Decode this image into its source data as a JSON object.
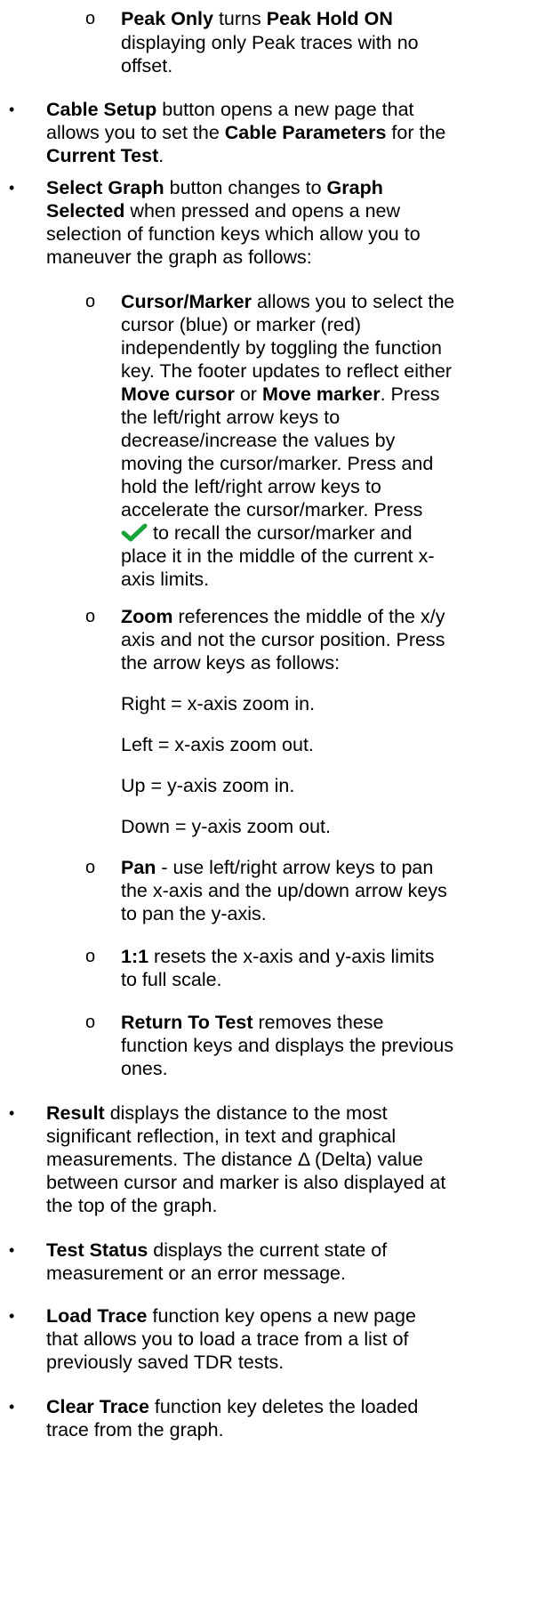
{
  "peak_only": {
    "bullet": "o",
    "t1": "Peak Only",
    "t2": " turns ",
    "t3": "Peak Hold ON",
    "line2": "displaying only Peak traces with no",
    "line3": "offset."
  },
  "cable_setup": {
    "bullet": "•",
    "t1": "Cable Setup",
    "t2": " button opens a new page that",
    "line2a": "allows you to set the ",
    "line2b": "Cable Parameters",
    "line2c": " for the",
    "line3a": "Current Test",
    "line3b": "."
  },
  "select_graph": {
    "bullet": "•",
    "t1": "Select Graph",
    "t2": " button changes to ",
    "t3": "Graph",
    "line2a": "Selected",
    "line2b": " when pressed and opens a new",
    "line3": "selection of function keys which allow you to",
    "line4": "maneuver the graph as follows:"
  },
  "cursor_marker": {
    "bullet": "o",
    "t1": "Cursor/Marker",
    "t2": " allows you to select the",
    "l2": "cursor (blue) or marker (red)",
    "l3": "independently by toggling the function",
    "l4": "key. The footer updates to reflect either",
    "l5a": "Move cursor",
    "l5b": " or ",
    "l5c": "Move marker",
    "l5d": ". Press",
    "l6": "the left/right arrow keys to",
    "l7": "decrease/increase the values by",
    "l8": "moving the cursor/marker. Press and",
    "l9": "hold the left/right arrow keys to",
    "l10": "accelerate the cursor/marker. Press",
    "l11": " to recall the cursor/marker and",
    "l12": "place it in the middle of the current x-",
    "l13": "axis limits.",
    "check_icon_color": "#1aa33a"
  },
  "zoom": {
    "bullet": "o",
    "t1": "Zoom",
    "t2": " references the middle of the x/y",
    "l2": "axis and not the cursor position. Press",
    "l3": "the arrow keys as follows:",
    "right": "Right = x-axis zoom in.",
    "left": "Left = x-axis zoom out.",
    "up": "Up = y-axis zoom in.",
    "down": "Down = y-axis zoom out."
  },
  "pan": {
    "bullet": "o",
    "t1": "Pan",
    "t2": " - use left/right arrow keys to pan",
    "l2": "the x-axis and the up/down arrow keys",
    "l3": "to pan the y-axis."
  },
  "one_to_one": {
    "bullet": "o",
    "t1": "1:1",
    "t2": " resets the x-axis and y-axis limits",
    "l2": "to full scale."
  },
  "return_to_test": {
    "bullet": "o",
    "t1": "Return To Test",
    "t2": " removes these",
    "l2": "function keys and displays the previous",
    "l3": "ones."
  },
  "result": {
    "bullet": "•",
    "t1": "Result",
    "t2": " displays the distance to the most",
    "l2": "significant reflection, in text and graphical",
    "l3": "measurements. The distance Δ (Delta) value",
    "l4": "between cursor and marker is also displayed at",
    "l5": "the top of the graph."
  },
  "test_status": {
    "bullet": "•",
    "t1": "Test Status",
    "t2": " displays the current state of",
    "l2": "measurement or an error message."
  },
  "load_trace": {
    "bullet": "•",
    "t1": "Load Trace",
    "t2": " function key opens a new page",
    "l2": "that allows you to load a trace from a list of",
    "l3": "previously saved TDR tests."
  },
  "clear_trace": {
    "bullet": "•",
    "t1": "Clear Trace",
    "t2": " function key deletes the loaded",
    "l2": "trace from the graph."
  }
}
